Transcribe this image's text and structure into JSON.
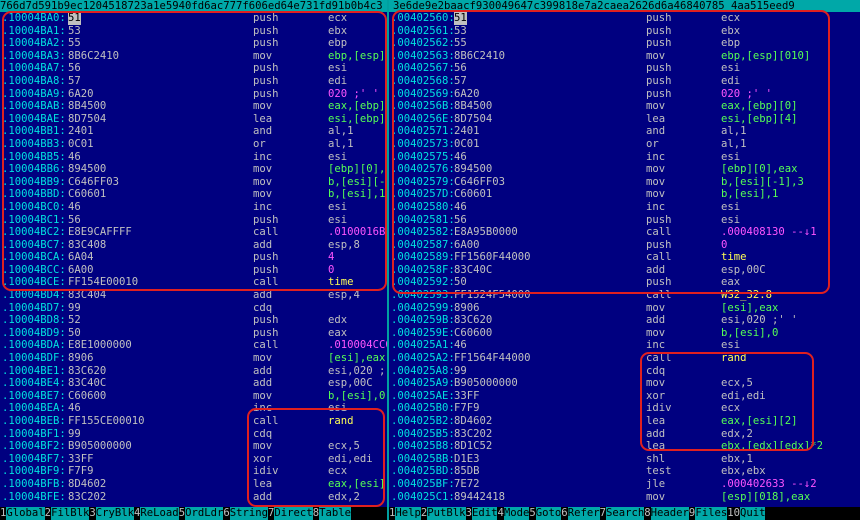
{
  "left": {
    "title": "766d7d591b9ec1204518723a1e5940fd6ac777f606ed64e731fd91b0b4c3",
    "rows": [
      {
        "addr": ".10004BA0:",
        "hex": "51",
        "mn": "push",
        "op": "ecx",
        "cursor": true
      },
      {
        "addr": ".10004BA1:",
        "hex": "53",
        "mn": "push",
        "op": "ebx"
      },
      {
        "addr": ".10004BA2:",
        "hex": "55",
        "mn": "push",
        "op": "ebp"
      },
      {
        "addr": ".10004BA3:",
        "hex": "8B6C2410",
        "mn": "mov",
        "op": "ebp,[esp]",
        "opclass": "green"
      },
      {
        "addr": ".10004BA7:",
        "hex": "56",
        "mn": "push",
        "op": "esi"
      },
      {
        "addr": ".10004BA8:",
        "hex": "57",
        "mn": "push",
        "op": "edi"
      },
      {
        "addr": ".10004BA9:",
        "hex": "6A20",
        "mn": "push",
        "op": "020 ;' '",
        "opclass": "magenta"
      },
      {
        "addr": ".10004BAB:",
        "hex": "8B4500",
        "mn": "mov",
        "op": "eax,[ebp]",
        "opclass": "green"
      },
      {
        "addr": ".10004BAE:",
        "hex": "8D7504",
        "mn": "lea",
        "op": "esi,[ebp]",
        "opclass": "green"
      },
      {
        "addr": ".10004BB1:",
        "hex": "2401",
        "mn": "and",
        "op": "al,1"
      },
      {
        "addr": ".10004BB3:",
        "hex": "0C01",
        "mn": "or",
        "op": "al,1"
      },
      {
        "addr": ".10004BB5:",
        "hex": "46",
        "mn": "inc",
        "op": "esi"
      },
      {
        "addr": ".10004BB6:",
        "hex": "894500",
        "mn": "mov",
        "op": "[ebp][0],",
        "opclass": "green"
      },
      {
        "addr": ".10004BB9:",
        "hex": "C646FF03",
        "mn": "mov",
        "op": "b,[esi][-",
        "opclass": "green"
      },
      {
        "addr": ".10004BBD:",
        "hex": "C60601",
        "mn": "mov",
        "op": "b,[esi],1",
        "opclass": "green"
      },
      {
        "addr": ".10004BC0:",
        "hex": "46",
        "mn": "inc",
        "op": "esi"
      },
      {
        "addr": ".10004BC1:",
        "hex": "56",
        "mn": "push",
        "op": "esi"
      },
      {
        "addr": ".10004BC2:",
        "hex": "E8E9CAFFFF",
        "mn": "call",
        "op": ".0100016B0",
        "opclass": "magenta"
      },
      {
        "addr": ".10004BC7:",
        "hex": "83C408",
        "mn": "add",
        "op": "esp,8"
      },
      {
        "addr": ".10004BCA:",
        "hex": "6A04",
        "mn": "push",
        "op": "4",
        "opclass": "magenta"
      },
      {
        "addr": ".10004BCC:",
        "hex": "6A00",
        "mn": "push",
        "op": "0",
        "opclass": "magenta"
      },
      {
        "addr": ".10004BCE:",
        "hex": "FF154E00010",
        "mn": "call",
        "op": "time",
        "opclass": "yellow"
      },
      {
        "addr": ".10004BD4:",
        "hex": "83C404",
        "mn": "add",
        "op": "esp,4"
      },
      {
        "addr": ".10004BD7:",
        "hex": "99",
        "mn": "cdq",
        "op": ""
      },
      {
        "addr": ".10004BD8:",
        "hex": "52",
        "mn": "push",
        "op": "edx"
      },
      {
        "addr": ".10004BD9:",
        "hex": "50",
        "mn": "push",
        "op": "eax"
      },
      {
        "addr": ".10004BDA:",
        "hex": "E8E1000000",
        "mn": "call",
        "op": ".010004CC0",
        "opclass": "magenta"
      },
      {
        "addr": ".10004BDF:",
        "hex": "8906",
        "mn": "mov",
        "op": "[esi],eax",
        "opclass": "green"
      },
      {
        "addr": ".10004BE1:",
        "hex": "83C620",
        "mn": "add",
        "op": "esi,020 ;"
      },
      {
        "addr": ".10004BE4:",
        "hex": "83C40C",
        "mn": "add",
        "op": "esp,00C"
      },
      {
        "addr": ".10004BE7:",
        "hex": "C60600",
        "mn": "mov",
        "op": "b,[esi],0",
        "opclass": "green"
      },
      {
        "addr": ".10004BEA:",
        "hex": "46",
        "mn": "inc",
        "op": "esi"
      },
      {
        "addr": ".10004BEB:",
        "hex": "FF155CE00010",
        "mn": "call",
        "op": "rand",
        "opclass": "yellow"
      },
      {
        "addr": ".10004BF1:",
        "hex": "99",
        "mn": "cdq",
        "op": ""
      },
      {
        "addr": ".10004BF2:",
        "hex": "B905000000",
        "mn": "mov",
        "op": "ecx,5"
      },
      {
        "addr": ".10004BF7:",
        "hex": "33FF",
        "mn": "xor",
        "op": "edi,edi"
      },
      {
        "addr": ".10004BF9:",
        "hex": "F7F9",
        "mn": "idiv",
        "op": "ecx"
      },
      {
        "addr": ".10004BFB:",
        "hex": "8D4602",
        "mn": "lea",
        "op": "eax,[esi]",
        "opclass": "green"
      },
      {
        "addr": ".10004BFE:",
        "hex": "83C202",
        "mn": "add",
        "op": "edx,2"
      }
    ],
    "fnkeys": [
      {
        "num": "1",
        "label": "Global"
      },
      {
        "num": "2",
        "label": "FilBlk"
      },
      {
        "num": "3",
        "label": "CryBlk"
      },
      {
        "num": "4",
        "label": "ReLoad"
      },
      {
        "num": "5",
        "label": "OrdLdr"
      },
      {
        "num": "6",
        "label": "String"
      },
      {
        "num": "7",
        "label": "Direct"
      },
      {
        "num": "8",
        "label": "Table"
      }
    ]
  },
  "right": {
    "title": "3e6de9e2baacf930049647c399818e7a2caea2626d6a46840785 4aa515eed9",
    "rows": [
      {
        "addr": ".00402560:",
        "hex": "51",
        "mn": "push",
        "op": "ecx",
        "cursor": true
      },
      {
        "addr": ".00402561:",
        "hex": "53",
        "mn": "push",
        "op": "ebx"
      },
      {
        "addr": ".00402562:",
        "hex": "55",
        "mn": "push",
        "op": "ebp"
      },
      {
        "addr": ".00402563:",
        "hex": "8B6C2410",
        "mn": "mov",
        "op": "ebp,[esp][010]",
        "opclass": "green"
      },
      {
        "addr": ".00402567:",
        "hex": "56",
        "mn": "push",
        "op": "esi"
      },
      {
        "addr": ".00402568:",
        "hex": "57",
        "mn": "push",
        "op": "edi"
      },
      {
        "addr": ".00402569:",
        "hex": "6A20",
        "mn": "push",
        "op": "020 ;' '",
        "opclass": "magenta"
      },
      {
        "addr": ".0040256B:",
        "hex": "8B4500",
        "mn": "mov",
        "op": "eax,[ebp][0]",
        "opclass": "green"
      },
      {
        "addr": ".0040256E:",
        "hex": "8D7504",
        "mn": "lea",
        "op": "esi,[ebp][4]",
        "opclass": "green"
      },
      {
        "addr": ".00402571:",
        "hex": "2401",
        "mn": "and",
        "op": "al,1"
      },
      {
        "addr": ".00402573:",
        "hex": "0C01",
        "mn": "or",
        "op": "al,1"
      },
      {
        "addr": ".00402575:",
        "hex": "46",
        "mn": "inc",
        "op": "esi"
      },
      {
        "addr": ".00402576:",
        "hex": "894500",
        "mn": "mov",
        "op": "[ebp][0],eax",
        "opclass": "green"
      },
      {
        "addr": ".00402579:",
        "hex": "C646FF03",
        "mn": "mov",
        "op": "b,[esi][-1],3",
        "opclass": "green"
      },
      {
        "addr": ".0040257D:",
        "hex": "C60601",
        "mn": "mov",
        "op": "b,[esi],1",
        "opclass": "green"
      },
      {
        "addr": ".00402580:",
        "hex": "46",
        "mn": "inc",
        "op": "esi"
      },
      {
        "addr": ".00402581:",
        "hex": "56",
        "mn": "push",
        "op": "esi"
      },
      {
        "addr": ".00402582:",
        "hex": "E8A95B0000",
        "mn": "call",
        "op": ".000408130 --↓1",
        "opclass": "magenta"
      },
      {
        "addr": ".00402587:",
        "hex": "6A00",
        "mn": "push",
        "op": "0",
        "opclass": "magenta"
      },
      {
        "addr": ".00402589:",
        "hex": "FF1560F44000",
        "mn": "call",
        "op": "time",
        "opclass": "yellow"
      },
      {
        "addr": ".0040258F:",
        "hex": "83C40C",
        "mn": "add",
        "op": "esp,00C"
      },
      {
        "addr": ".00402592:",
        "hex": "50",
        "mn": "push",
        "op": "eax"
      },
      {
        "addr": ".00402593:",
        "hex": "FF1524F54000",
        "mn": "call",
        "op": "WS2_32.8",
        "opclass": "yellow"
      },
      {
        "addr": ".00402599:",
        "hex": "8906",
        "mn": "mov",
        "op": "[esi],eax",
        "opclass": "green"
      },
      {
        "addr": ".0040259B:",
        "hex": "83C620",
        "mn": "add",
        "op": "esi,020 ;' '"
      },
      {
        "addr": ".0040259E:",
        "hex": "C60600",
        "mn": "mov",
        "op": "b,[esi],0",
        "opclass": "green"
      },
      {
        "addr": ".004025A1:",
        "hex": "46",
        "mn": "inc",
        "op": "esi"
      },
      {
        "addr": ".004025A2:",
        "hex": "FF1564F44000",
        "mn": "call",
        "op": "rand",
        "opclass": "yellow"
      },
      {
        "addr": ".004025A8:",
        "hex": "99",
        "mn": "cdq",
        "op": ""
      },
      {
        "addr": ".004025A9:",
        "hex": "B905000000",
        "mn": "mov",
        "op": "ecx,5"
      },
      {
        "addr": ".004025AE:",
        "hex": "33FF",
        "mn": "xor",
        "op": "edi,edi"
      },
      {
        "addr": ".004025B0:",
        "hex": "F7F9",
        "mn": "idiv",
        "op": "ecx"
      },
      {
        "addr": ".004025B2:",
        "hex": "8D4602",
        "mn": "lea",
        "op": "eax,[esi][2]",
        "opclass": "green"
      },
      {
        "addr": ".004025B5:",
        "hex": "83C202",
        "mn": "add",
        "op": "edx,2"
      },
      {
        "addr": ".004025B8:",
        "hex": "8D1C52",
        "mn": "lea",
        "op": "ebx,[edx][edx]*2",
        "opclass": "green"
      },
      {
        "addr": ".004025BB:",
        "hex": "D1E3",
        "mn": "shl",
        "op": "ebx,1"
      },
      {
        "addr": ".004025BD:",
        "hex": "85DB",
        "mn": "test",
        "op": "ebx,ebx"
      },
      {
        "addr": ".004025BF:",
        "hex": "7E72",
        "mn": "jle",
        "op": ".000402633 --↓2",
        "opclass": "magenta"
      },
      {
        "addr": ".004025C1:",
        "hex": "89442418",
        "mn": "mov",
        "op": "[esp][018],eax",
        "opclass": "green"
      }
    ],
    "fnkeys": [
      {
        "num": "1",
        "label": "Help"
      },
      {
        "num": "2",
        "label": "PutBlk"
      },
      {
        "num": "3",
        "label": "Edit"
      },
      {
        "num": "4",
        "label": "Mode"
      },
      {
        "num": "5",
        "label": "Goto"
      },
      {
        "num": "6",
        "label": "Refer"
      },
      {
        "num": "7",
        "label": "Search"
      },
      {
        "num": "8",
        "label": "Header"
      },
      {
        "num": "9",
        "label": "Files"
      },
      {
        "num": "10",
        "label": "Quit"
      }
    ]
  },
  "colors": {
    "background": "#000080",
    "titlebar": "#00a8a8",
    "annotation": "#e02020",
    "address": "#00e0e0",
    "immediate": "#ff55ff",
    "import": "#ffff55",
    "memory": "#55ff55"
  }
}
